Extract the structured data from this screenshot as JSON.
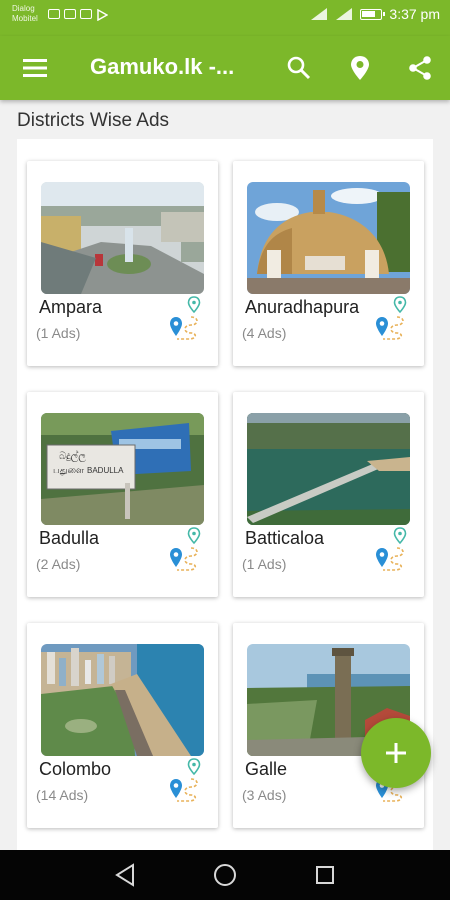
{
  "status_bar": {
    "carrier_line1": "Dialog",
    "carrier_line2": "Mobitel",
    "time": "3:37 pm"
  },
  "app_bar": {
    "title": "Gamuko.lk -..."
  },
  "section": {
    "title": "Districts Wise Ads"
  },
  "districts": [
    {
      "name": "Ampara",
      "ads": "(1 Ads)"
    },
    {
      "name": "Anuradhapura",
      "ads": "(4 Ads)"
    },
    {
      "name": "Badulla",
      "ads": "(2 Ads)"
    },
    {
      "name": "Batticaloa",
      "ads": "(1 Ads)"
    },
    {
      "name": "Colombo",
      "ads": "(14 Ads)"
    },
    {
      "name": "Galle",
      "ads": "(3 Ads)"
    }
  ],
  "photo_texts": {
    "badulla_sign_sinhala": "බදුල්ල",
    "badulla_sign_tamil": "பதுளை",
    "badulla_sign_english": "BADULLA"
  },
  "colors": {
    "brand_green": "#7cb82a",
    "pin_blue": "#2a8fd6",
    "pin_teal": "#44b8a8",
    "route_orange": "#e8b25a"
  },
  "icons": {
    "menu": "hamburger-icon",
    "search": "search-icon",
    "location": "location-pin-icon",
    "share": "share-icon",
    "fab": "plus-icon",
    "district": "route-pins-icon"
  }
}
